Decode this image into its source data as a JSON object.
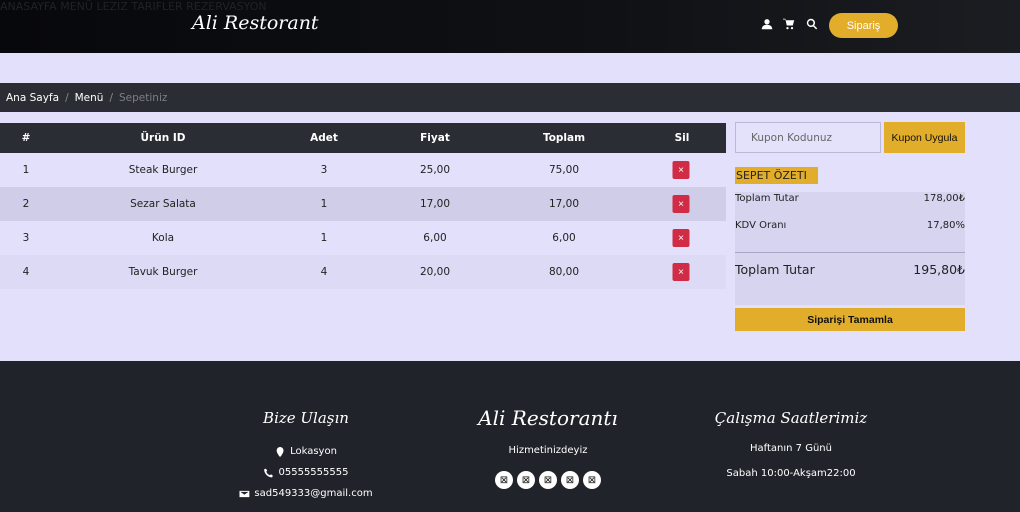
{
  "header": {
    "brand": "Ali Restorant",
    "nav": [
      "ANASAYFA",
      "MENÜ",
      "LEZIZ TARIFLER",
      "REZERVASYON"
    ],
    "order_button": "Sipariş"
  },
  "breadcrumb": {
    "items": [
      "Ana Sayfa",
      "Menü"
    ],
    "active": "Sepetiniz"
  },
  "cart": {
    "columns": [
      "#",
      "Ürün ID",
      "Adet",
      "Fiyat",
      "Toplam",
      "Sil"
    ],
    "rows": [
      {
        "no": "1",
        "name": "Steak Burger",
        "qty": "3",
        "price": "25,00",
        "total": "75,00"
      },
      {
        "no": "2",
        "name": "Sezar Salata",
        "qty": "1",
        "price": "17,00",
        "total": "17,00"
      },
      {
        "no": "3",
        "name": "Kola",
        "qty": "1",
        "price": "6,00",
        "total": "6,00"
      },
      {
        "no": "4",
        "name": "Tavuk Burger",
        "qty": "4",
        "price": "20,00",
        "total": "80,00"
      }
    ],
    "delete_symbol": "×"
  },
  "coupon": {
    "placeholder": "Kupon Kodunuz",
    "button": "Kupon Uygula"
  },
  "summary": {
    "title": "SEPET ÖZETI",
    "subtotal_label": "Toplam Tutar",
    "subtotal_value": "178,00₺",
    "tax_label": "KDV Oranı",
    "tax_value": "17,80%",
    "total_label": "Toplam Tutar",
    "total_value": "195,80₺",
    "complete_button": "Siparişi Tamamla"
  },
  "footer": {
    "contact_title": "Bize Ulaşın",
    "location": "Lokasyon",
    "phone": "05555555555",
    "email": "sad549333@gmail.com",
    "brand_title": "Ali Restorantı",
    "brand_tagline": "Hizmetinizdeyiz",
    "social_symbol": "⊠",
    "hours_title": "Çalışma Saatlerimiz",
    "hours_days": "Haftanın 7 Günü",
    "hours_time": "Sabah 10:00-Akşam22:00"
  },
  "colors": {
    "accent": "#e2ad2b",
    "danger": "#d12c45",
    "dark": "#2a2d33",
    "page_bg": "#e2e0fb"
  }
}
